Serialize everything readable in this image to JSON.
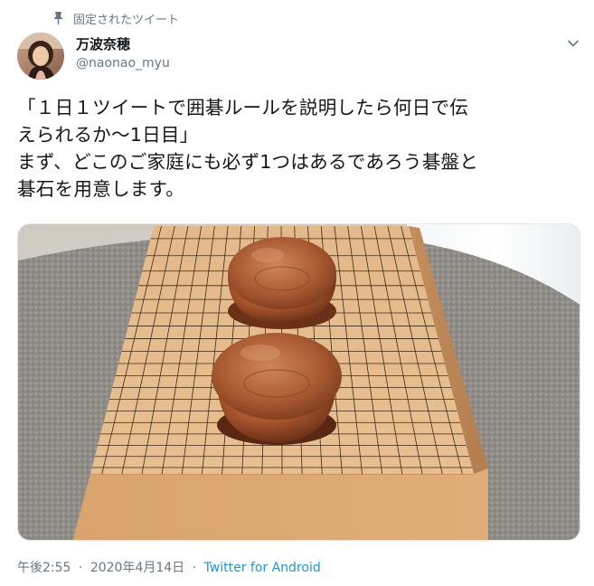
{
  "pinned": {
    "label": "固定されたツイート",
    "icon": "pin-icon"
  },
  "author": {
    "display_name": "万波奈穂",
    "handle": "@naonao_myu",
    "avatar": "avatar"
  },
  "menu": {
    "icon": "chevron-down-icon"
  },
  "tweet": {
    "lines": [
      "「１日１ツイートで囲碁ルールを説明したら何日で伝",
      "えられるか～1日目」",
      "まず、どこのご家庭にも必ず1つはあるであろう碁盤と",
      "碁石を用意します。"
    ]
  },
  "media": {
    "description_icon": "go-board-photo"
  },
  "meta": {
    "time": "午後2:55",
    "separator": "·",
    "date": "2020年4月14日",
    "source": "Twitter for Android"
  },
  "colors": {
    "secondary_text": "#657786",
    "link": "#1b95e0",
    "primary_text": "#14171a"
  }
}
